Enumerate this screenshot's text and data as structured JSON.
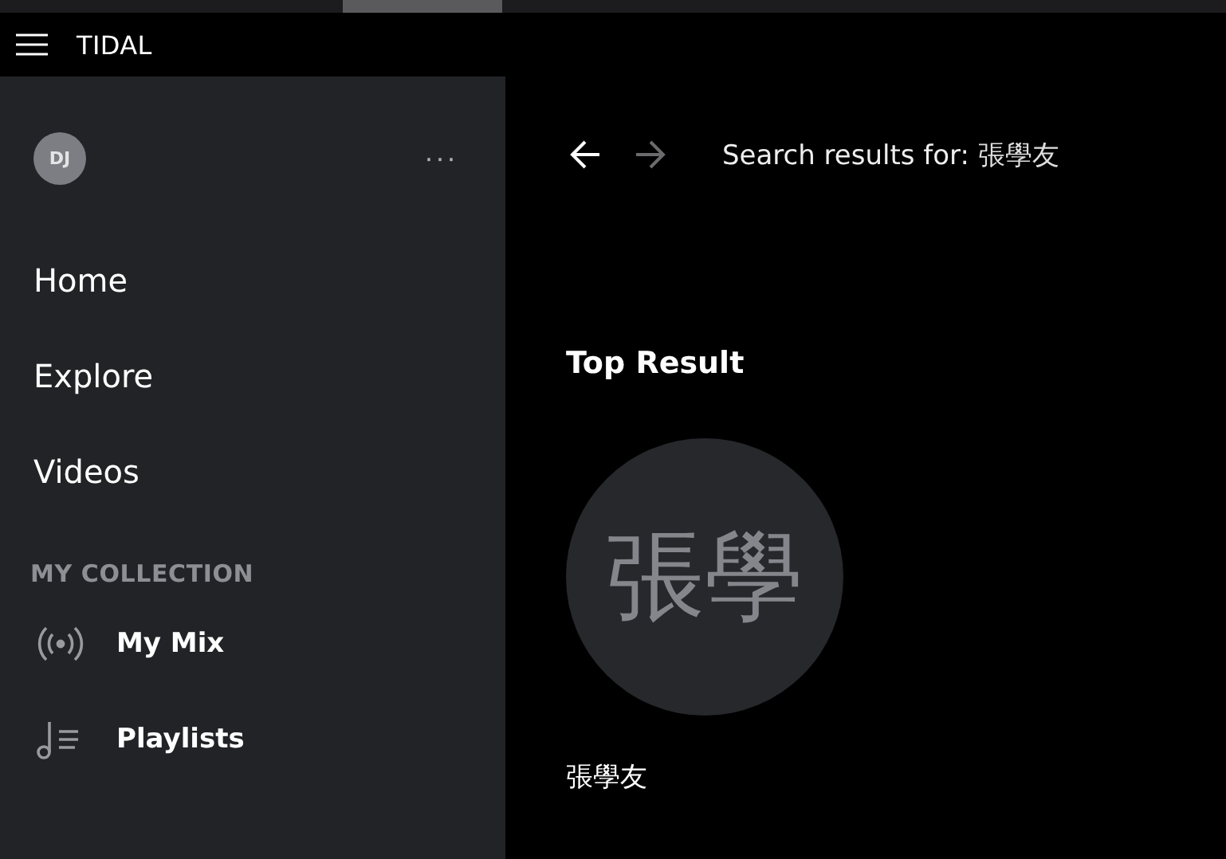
{
  "app_bar": {
    "title": "TIDAL"
  },
  "profile": {
    "initials": "DJ",
    "more": "···"
  },
  "nav": [
    {
      "label": "Home",
      "selected": false
    },
    {
      "label": "Explore",
      "selected": false
    },
    {
      "label": "Videos",
      "selected": false
    }
  ],
  "collection": {
    "heading": "MY COLLECTION",
    "items": [
      {
        "kind": "mix",
        "label": "My Mix"
      },
      {
        "kind": "playlists",
        "label": "Playlists"
      }
    ]
  },
  "history": {
    "back": {
      "disabled": false
    },
    "forward": {
      "disabled": true
    }
  },
  "search_header": {
    "prefix": "Search results for: ",
    "query": "張學友"
  },
  "top_result": {
    "heading": "Top Result",
    "artwork_text": "張學",
    "name": "張學友"
  }
}
